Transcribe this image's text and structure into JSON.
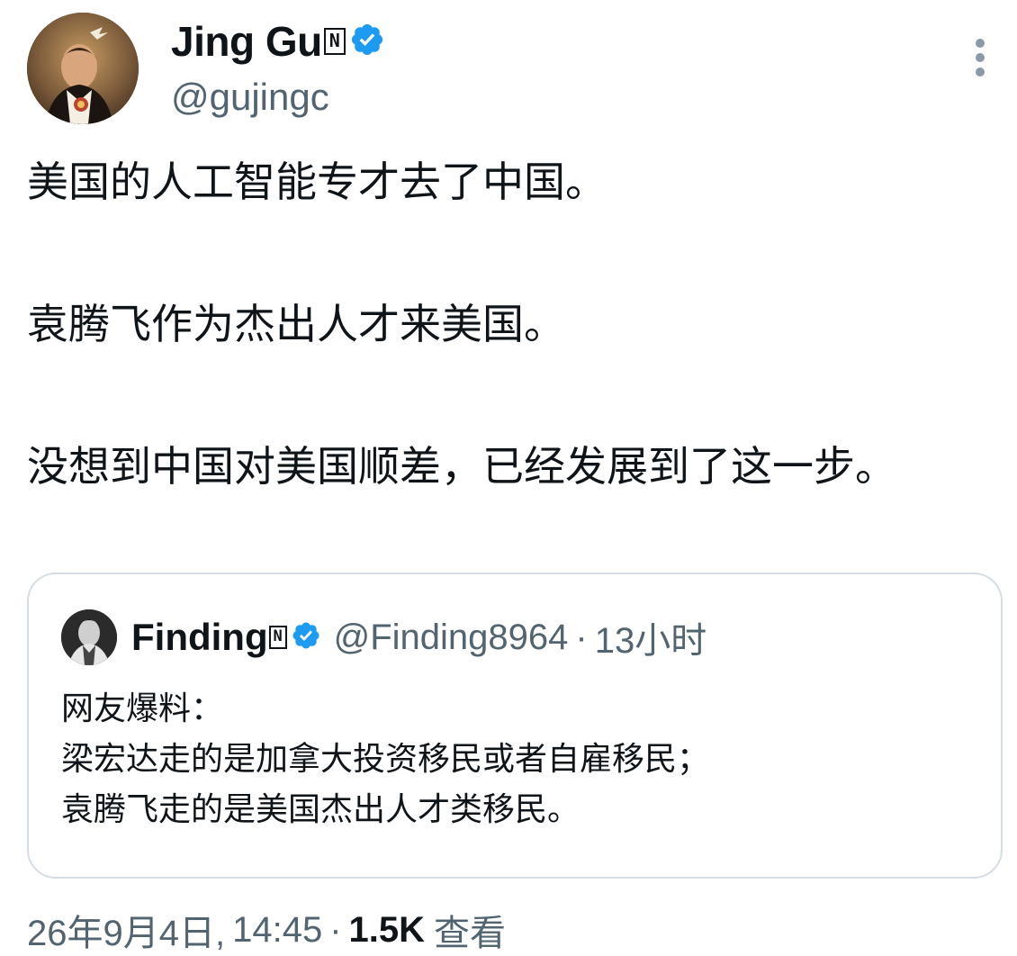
{
  "tweet": {
    "author": {
      "display_name": "Jing Gu",
      "n_badge": "N",
      "handle": "@gujingc"
    },
    "paragraphs": [
      "美国的人工智能专才去了中国。",
      "袁腾飞作为杰出人才来美国。",
      "没想到中国对美国顺差，已经发展到了这一步。"
    ],
    "quoted": {
      "display_name": "Finding",
      "n_badge": "N",
      "handle": "@Finding8964",
      "separator": "·",
      "time": "13小时",
      "lines": [
        "网友爆料：",
        "梁宏达走的是加拿大投资移民或者自雇移民；",
        "袁腾飞走的是美国杰出人才类移民。"
      ]
    },
    "meta": {
      "date": "26年9月4日,",
      "time": "14:45",
      "separator": "·",
      "views_count": "1.5K",
      "views_label": "查看"
    },
    "colors": {
      "verified_blue": "#1d9bf0",
      "text_primary": "#0f1419",
      "text_secondary": "#536471",
      "border": "#d6dde2"
    },
    "icons": {
      "verified": "verified-badge-icon",
      "more": "more-vertical-icon"
    }
  }
}
